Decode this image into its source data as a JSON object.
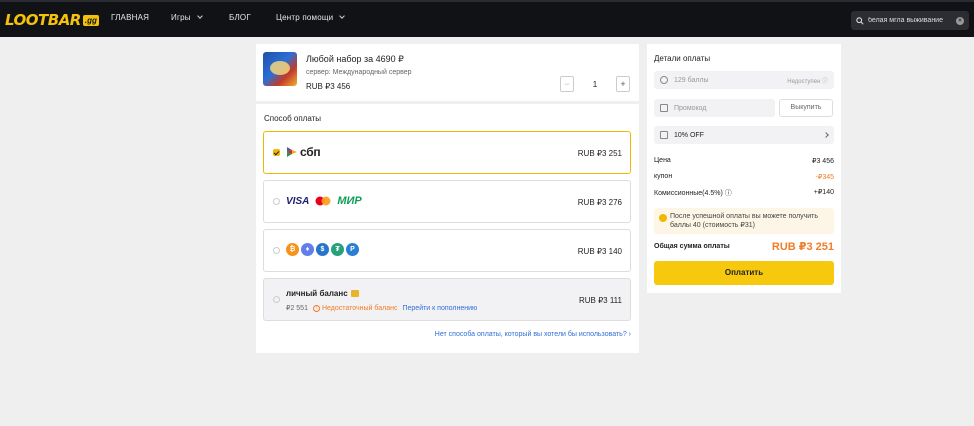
{
  "header": {
    "logo": "LOOTBAR",
    "logo_badge": ".gg",
    "nav": [
      "ГЛАВНАЯ",
      "Игры",
      "БЛОГ",
      "Центр помощи"
    ],
    "search_value": "белая мгла выживание"
  },
  "product": {
    "title": "Любой набор за 4690 ₽",
    "server": "сервер: Международный сервер",
    "price": "RUB ₽3 456",
    "quantity": "1",
    "minus": "−",
    "plus": "+"
  },
  "payment": {
    "title": "Способ оплаты",
    "methods": [
      {
        "logo_text": "сбп",
        "amount": "RUB ₽3 251"
      },
      {
        "visa": "VISA",
        "mir": "МИР",
        "amount": "RUB ₽3 276"
      },
      {
        "amount": "RUB ₽3 140"
      },
      {
        "label": "личный баланс",
        "balance": "₽2 551",
        "warning": "Недостаточный баланс",
        "topup": "Перейти к пополнению",
        "amount": "RUB ₽3 111"
      }
    ],
    "other_link": "Нет способа оплаты, который вы хотели бы использовать? ›"
  },
  "details": {
    "title": "Детали оплаты",
    "points_placeholder": "129 баллы",
    "points_status": "Недоступен ⓘ",
    "promo_placeholder": "Промокод",
    "redeem": "Выкупить",
    "coupon": "10% OFF",
    "price_label": "Цена",
    "price_value": "₽3 456",
    "coupon_label": "купон",
    "coupon_value": "-₽345",
    "fee_label": "Комиссионные(4.5%) ⓘ",
    "fee_value": "+₽140",
    "info": "После успешной оплаты вы можете получить баллы 40 (стоимость ₽31)",
    "total_label": "Общая сумма оплаты",
    "total_value": "RUB ₽3 251",
    "pay_button": "Оплатить"
  },
  "colors": {
    "accent": "#f6c90e",
    "warning": "#f07c28",
    "link": "#2f6fd6"
  }
}
